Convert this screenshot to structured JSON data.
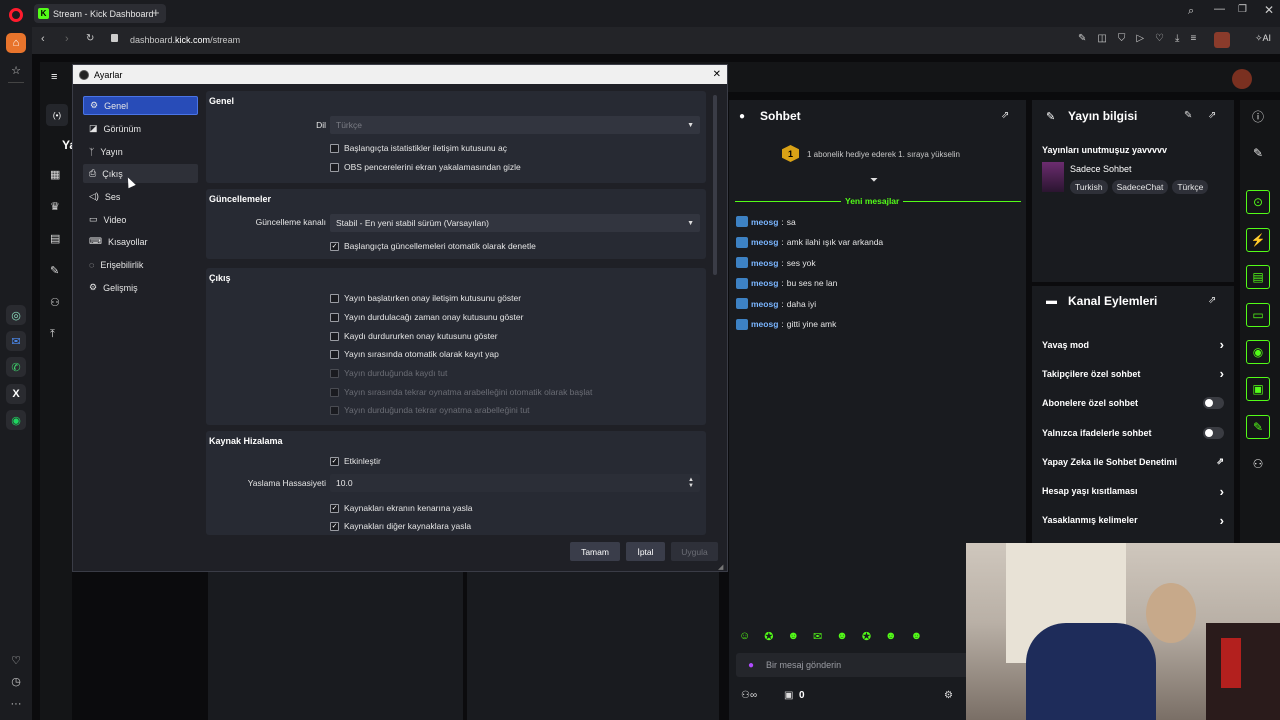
{
  "browser": {
    "tab_title": "Stream - Kick Dashboard",
    "url_prefix": "dashboard.",
    "url_domain": "kick.com",
    "url_path": "/stream",
    "ai_label": "AI"
  },
  "kick": {
    "left_partial_label": "Ya",
    "chat": {
      "title": "Sohbet",
      "gift_badge": "1",
      "gift_text": "1 abonelik hediye ederek 1. sıraya yükselin",
      "new_messages": "Yeni mesajlar",
      "messages": [
        {
          "user": "meosg",
          "text": "sa"
        },
        {
          "user": "meosg",
          "text": "amk ilahi ışık var arkanda"
        },
        {
          "user": "meosg",
          "text": "ses yok"
        },
        {
          "user": "meosg",
          "text": "bu ses ne lan"
        },
        {
          "user": "meosg",
          "text": "daha iyi"
        },
        {
          "user": "meosg",
          "text": "gitti yine amk"
        }
      ],
      "input_placeholder": "Bir mesaj gönderin",
      "viewer_count": "0"
    },
    "stream_info": {
      "title": "Yayın bilgisi",
      "stream_title": "Yayınları unutmuşuz yavvvvv",
      "category": "Sadece Sohbet",
      "tags": [
        "Turkish",
        "SadeceChat",
        "Türkçe"
      ]
    },
    "channel_actions": {
      "title": "Kanal Eylemleri",
      "items": [
        {
          "label": "Yavaş mod",
          "control": "chevron"
        },
        {
          "label": "Takipçilere özel sohbet",
          "control": "chevron"
        },
        {
          "label": "Abonelere özel sohbet",
          "control": "toggle"
        },
        {
          "label": "Yalnızca ifadelerle sohbet",
          "control": "toggle"
        },
        {
          "label": "Yapay Zeka ile Sohbet Denetimi",
          "control": "external"
        },
        {
          "label": "Hesap yaşı kısıtlaması",
          "control": "chevron"
        },
        {
          "label": "Yasaklanmış kelimeler",
          "control": "chevron"
        }
      ]
    }
  },
  "settings": {
    "window_title": "Ayarlar",
    "nav": [
      {
        "label": "Genel",
        "icon": "gear-icon"
      },
      {
        "label": "Görünüm",
        "icon": "appearance-icon"
      },
      {
        "label": "Yayın",
        "icon": "antenna-icon"
      },
      {
        "label": "Çıkış",
        "icon": "output-icon"
      },
      {
        "label": "Ses",
        "icon": "speaker-icon"
      },
      {
        "label": "Video",
        "icon": "monitor-icon"
      },
      {
        "label": "Kısayollar",
        "icon": "keyboard-icon"
      },
      {
        "label": "Erişebilirlik",
        "icon": "accessibility-icon"
      },
      {
        "label": "Gelişmiş",
        "icon": "advanced-icon"
      }
    ],
    "general": {
      "title": "Genel",
      "language_label": "Dil",
      "language_value": "Türkçe",
      "cb1": "Başlangıçta istatistikler iletişim kutusunu aç",
      "cb2": "OBS pencerelerini ekran yakalamasından gizle"
    },
    "updates": {
      "title": "Güncellemeler",
      "channel_label": "Güncelleme kanalı",
      "channel_value": "Stabil - En yeni stabil sürüm (Varsayılan)",
      "cb1": "Başlangıçta güncellemeleri otomatik olarak denetle"
    },
    "output": {
      "title": "Çıkış",
      "cb1": "Yayın başlatırken onay iletişim kutusunu göster",
      "cb2": "Yayın durdulacağı zaman onay kutusunu göster",
      "cb3": "Kaydı durdururken onay kutusunu göster",
      "cb4": "Yayın sırasında otomatik olarak kayıt yap",
      "cb5": "Yayın durduğunda kaydı tut",
      "cb6": "Yayın sırasında tekrar oynatma arabelleğini otomatik olarak başlat",
      "cb7": "Yayın durduğunda tekrar oynatma arabelleğini tut"
    },
    "snapping": {
      "title": "Kaynak Hizalama",
      "enable": "Etkinleştir",
      "sensitivity_label": "Yaslama Hassasiyeti",
      "sensitivity_value": "10.0",
      "cb1": "Kaynakları ekranın kenarına yasla",
      "cb2": "Kaynakları diğer kaynaklara yasla"
    },
    "buttons": {
      "ok": "Tamam",
      "cancel": "İptal",
      "apply": "Uygula"
    }
  }
}
